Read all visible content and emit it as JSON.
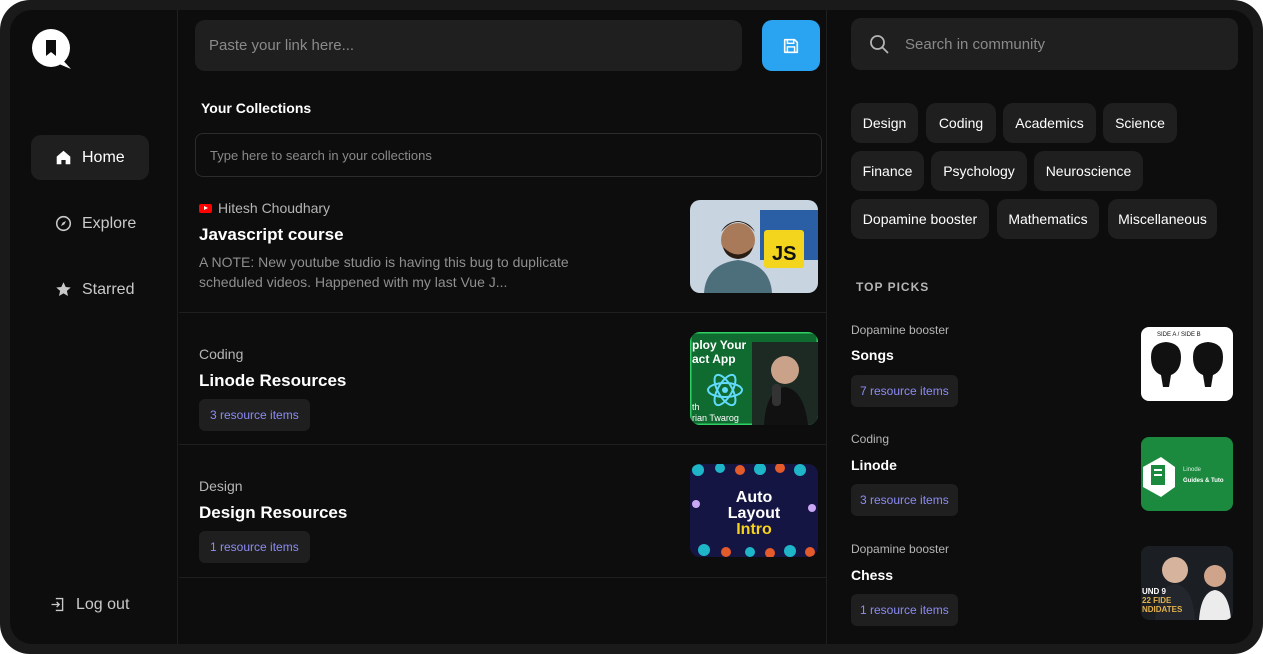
{
  "sidebar": {
    "nav": [
      {
        "label": "Home",
        "icon": "home-icon"
      },
      {
        "label": "Explore",
        "icon": "compass-icon"
      },
      {
        "label": "Starred",
        "icon": "star-icon"
      }
    ],
    "logout_label": "Log out"
  },
  "main": {
    "link_placeholder": "Paste your link here...",
    "collections_title": "Your Collections",
    "collections_search_placeholder": "Type here to search in your collections",
    "collections": [
      {
        "meta": "Hitesh Choudhary",
        "source_icon": "youtube-icon",
        "title": "Javascript course",
        "description": "A NOTE: New youtube studio is having this bug to duplicate scheduled videos. Happened with my last Vue J...",
        "thumbnail": "Javascript course thumbnail (JS)",
        "thumb_text": "JS"
      },
      {
        "meta": "Coding",
        "title": "Linode Resources",
        "badge": "3 resource items",
        "thumb_text_1": "ploy Your",
        "thumb_text_2": "act App",
        "thumb_text_3": "th",
        "thumb_text_4": "rian Twarog"
      },
      {
        "meta": "Design",
        "title": "Design Resources",
        "badge": "1 resource items",
        "thumb_text_1": "Auto",
        "thumb_text_2": "Layout",
        "thumb_text_3": "Intro"
      }
    ]
  },
  "community": {
    "search_placeholder": "Search in community",
    "tags": [
      "Design",
      "Coding",
      "Academics",
      "Science",
      "Finance",
      "Psychology",
      "Neuroscience",
      "Dopamine booster",
      "Mathematics",
      "Miscellaneous"
    ],
    "top_picks_label": "TOP PICKS",
    "picks": [
      {
        "category": "Dopamine booster",
        "title": "Songs",
        "badge": "7 resource items",
        "thumb_text": "SIDE A / SIDE B"
      },
      {
        "category": "Coding",
        "title": "Linode",
        "badge": "3 resource items",
        "thumb_text_1": "Linode",
        "thumb_text_2": "Guides & Tuto"
      },
      {
        "category": "Dopamine booster",
        "title": "Chess",
        "badge": "1 resource items",
        "thumb_text_1": "UND 9",
        "thumb_text_2": "22 FIDE",
        "thumb_text_3": "NDIDATES"
      }
    ]
  },
  "colors": {
    "accent": "#2aa3f0",
    "badge_text": "#8c8cf5",
    "background": "#0d0d0d",
    "surface": "#1f1f1f"
  }
}
